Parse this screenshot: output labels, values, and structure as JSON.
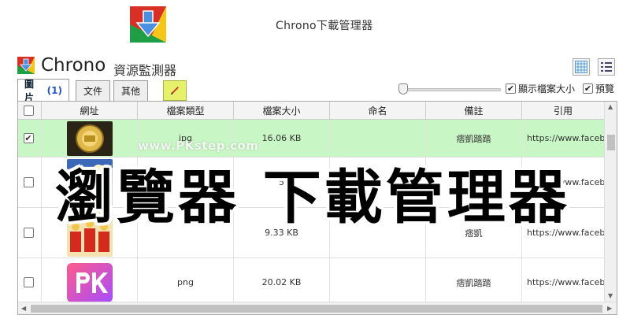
{
  "banner": {
    "title": "Chrono下載管理器"
  },
  "app": {
    "name": "Chrono",
    "subtitle": "資源監測器"
  },
  "tabs": [
    {
      "label": "圖片",
      "count": "(1)",
      "active": true
    },
    {
      "label": "文件",
      "active": false
    },
    {
      "label": "其他",
      "active": false
    }
  ],
  "toolbar": {
    "pen_icon": "pencil-icon",
    "show_size_label": "顯示檔案大小",
    "show_size_checked": true,
    "preview_label": "預覽",
    "preview_checked": true,
    "thumbnail_slider_level": 0.0
  },
  "table": {
    "columns": [
      "網址",
      "檔案類型",
      "檔案大小",
      "命名",
      "備註",
      "引用"
    ],
    "rows": [
      {
        "checked": true,
        "thumb": "gold-coin-thumbnail",
        "type": "jpg",
        "size": "16.06 KB",
        "name": "",
        "note": "痞凱踏踏",
        "ref": "https://www.faceb",
        "selected": true
      },
      {
        "checked": false,
        "thumb": "sky-photo-thumbnail",
        "type": "j",
        "size": "5",
        "name": "",
        "note": "",
        "ref": "https://www.faceb",
        "selected": false
      },
      {
        "checked": false,
        "thumb": "red-figures-thumbnail",
        "type": "",
        "size": "9.33 KB",
        "name": "",
        "note": "痞凱",
        "ref": "https://www.faceb",
        "selected": false
      },
      {
        "checked": false,
        "thumb": "pk-logo-thumbnail",
        "type": "png",
        "size": "20.02 KB",
        "name": "",
        "note": "痞凱踏踏",
        "ref": "https://www.faceb",
        "selected": false
      }
    ]
  },
  "overlay": {
    "watermark": "www.PKstep.com",
    "title": "瀏覽器 下載管理器"
  },
  "colors": {
    "selected_row": "#c8f7c5",
    "logo_red": "#d93025",
    "logo_yellow": "#f5c518",
    "logo_green": "#1e9e45",
    "logo_arrow": "#4a8fe0",
    "pen_tab": "#e6f06a"
  }
}
